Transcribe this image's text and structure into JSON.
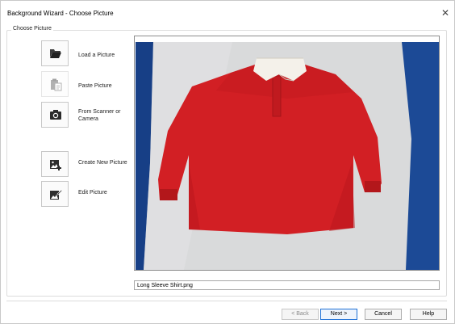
{
  "window": {
    "title": "Background Wizard - Choose Picture",
    "close_glyph": "✕"
  },
  "group": {
    "label": "Choose Picture"
  },
  "actions": [
    {
      "label": "Load a Picture",
      "icon": "folder-open-icon",
      "enabled": true
    },
    {
      "label": "Paste Picture",
      "icon": "clipboard-paste-icon",
      "enabled": false
    },
    {
      "label": "From Scanner or Camera",
      "icon": "camera-icon",
      "enabled": true
    },
    {
      "label": "Create New Picture",
      "icon": "image-add-icon",
      "enabled": true
    },
    {
      "label": "Edit Picture",
      "icon": "image-edit-icon",
      "enabled": true
    }
  ],
  "preview": {
    "filename": "Long Sleeve Shirt.png"
  },
  "footer": {
    "back_label": "< Back",
    "next_label": "Next >",
    "cancel_label": "Cancel",
    "help_label": "Help"
  },
  "colors": {
    "shirt": "#d21f24",
    "collar": "#f4f1ea",
    "backdrop": "#1c4a96",
    "cloth": "#d9dadb"
  }
}
